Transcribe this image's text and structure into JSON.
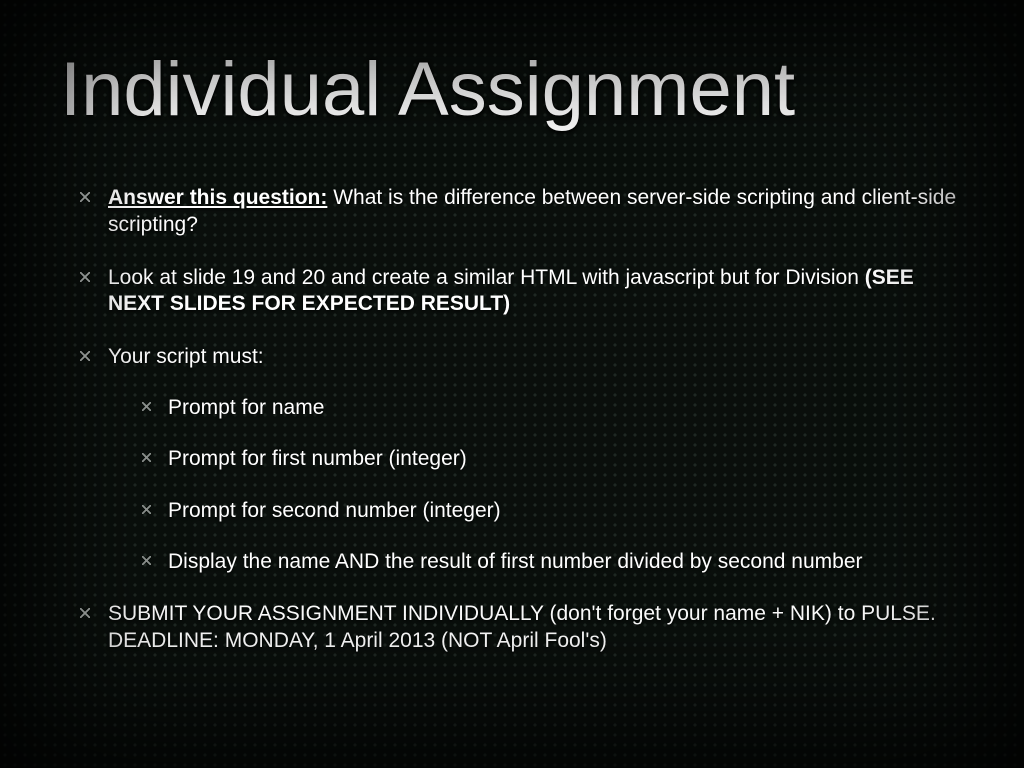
{
  "title": "Individual Assignment",
  "items": [
    {
      "lead_bold_underline": "Answer this question:",
      "rest": " What is the difference between server-side scripting and client-side scripting?"
    },
    {
      "line1": "Look at slide 19 and 20 and create a similar HTML with javascript but for Division ",
      "bold_tail": "(SEE NEXT SLIDES FOR EXPECTED RESULT)"
    },
    {
      "text": "Your script must:",
      "sub": [
        "Prompt for name",
        "Prompt for first number (integer)",
        "Prompt for second number (integer)",
        "Display the name AND the result of first number divided by second number"
      ]
    },
    {
      "text": "SUBMIT YOUR ASSIGNMENT INDIVIDUALLY (don't forget your name + NIK) to PULSE. DEADLINE: MONDAY, 1 April 2013 (NOT April Fool's)"
    }
  ]
}
